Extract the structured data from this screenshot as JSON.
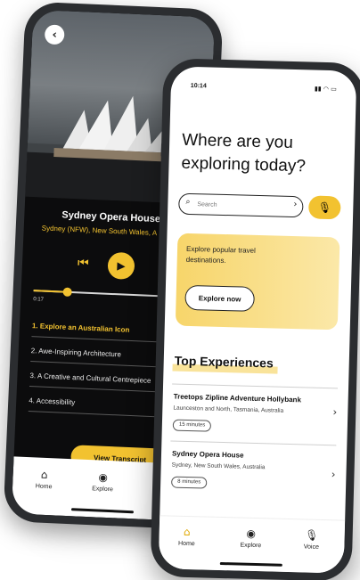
{
  "back_phone": {
    "place_title": "Sydney Opera House",
    "place_subtitle": "Sydney (NFW), New South Wales, A",
    "player": {
      "prev_icon": "skip-previous-icon",
      "play_icon": "play-icon",
      "next_icon": "skip-next-icon",
      "elapsed": "0:17",
      "progress": 0.2
    },
    "chapters": [
      "1. Explore an Australian Icon",
      "2. Awe-Inspiring Architecture",
      "3. A Creative and Cultural Centrepiece",
      "4. Accessibility"
    ],
    "transcript_button": "View Transcript",
    "nav": [
      {
        "label": "Home",
        "icon": "home-icon"
      },
      {
        "label": "Explore",
        "icon": "location-pin-icon"
      }
    ]
  },
  "front_phone": {
    "status_time": "10:14",
    "headline": "Where are you exploring today?",
    "search": {
      "placeholder": "Search"
    },
    "promo": {
      "text": "Explore popular travel destinations.",
      "button": "Explore now"
    },
    "section_title": "Top Experiences",
    "experiences": [
      {
        "title": "Treetops Zipline Adventure Hollybank",
        "location": "Launceston and North, Tasmania, Australia",
        "duration": "15 minutes"
      },
      {
        "title": "Sydney Opera House",
        "location": "Sydney, New South Wales, Australia",
        "duration": "8 minutes"
      }
    ],
    "nav": [
      {
        "label": "Home",
        "icon": "home-icon"
      },
      {
        "label": "Explore",
        "icon": "location-pin-icon"
      },
      {
        "label": "Voice",
        "icon": "microphone-icon"
      }
    ]
  },
  "colors": {
    "accent": "#f2c230",
    "dark_screen": "#0c0c0d",
    "frame": "#2b2d30"
  }
}
